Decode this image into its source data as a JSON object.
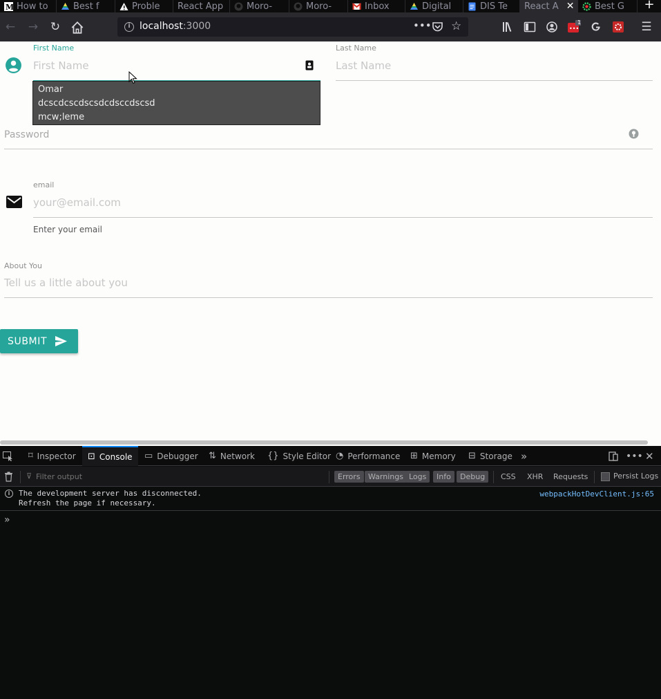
{
  "browser": {
    "tabs": [
      {
        "label": "How to",
        "icon": "medium-icon",
        "active": false
      },
      {
        "label": "Best f",
        "icon": "google-drive-icon",
        "active": false
      },
      {
        "label": "Proble",
        "icon": "warning-icon",
        "active": false
      },
      {
        "label": "React App",
        "icon": "",
        "active": false
      },
      {
        "label": "Moro-",
        "icon": "github-icon",
        "active": false
      },
      {
        "label": "Moro-",
        "icon": "github-icon",
        "active": false
      },
      {
        "label": "Inbox",
        "icon": "gmail-icon",
        "active": false
      },
      {
        "label": "Digital",
        "icon": "google-drive-icon",
        "active": false
      },
      {
        "label": "DIS Te",
        "icon": "google-docs-icon",
        "active": false
      },
      {
        "label": "React A",
        "icon": "",
        "active": true
      },
      {
        "label": "Best G",
        "icon": "gear-icon",
        "active": false
      }
    ],
    "url_host": "localhost",
    "url_port": ":3000",
    "badge_count": "1"
  },
  "form": {
    "first_name": {
      "label": "First Name",
      "placeholder": "First Name"
    },
    "last_name": {
      "label": "Last Name",
      "placeholder": "Last Name"
    },
    "suggestions": [
      "Omar",
      "dcscdcscdscsdcdsccdscsd",
      "mcw;leme"
    ],
    "password": {
      "placeholder": "Password"
    },
    "email": {
      "label": "email",
      "placeholder": "your@email.com",
      "helper": "Enter your email"
    },
    "about": {
      "label": "About You",
      "placeholder": "Tell us a little about you"
    },
    "submit_label": "SUBMIT"
  },
  "devtools": {
    "tabs": [
      "Inspector",
      "Console",
      "Debugger",
      "Network",
      "Style Editor",
      "Performance",
      "Memory",
      "Storage"
    ],
    "active_tab": "Console",
    "filter_placeholder": "Filter output",
    "levels": [
      "Errors",
      "Warnings",
      "Logs",
      "Info",
      "Debug"
    ],
    "types": [
      "CSS",
      "XHR",
      "Requests"
    ],
    "persist_label": "Persist Logs",
    "messages": [
      {
        "line1": "The development server has disconnected.",
        "line2": "Refresh the page if necessary.",
        "source": "webpackHotDevClient.js:65"
      }
    ],
    "prompt": "»"
  },
  "colors": {
    "accent": "#26a69a",
    "devtools_active": "#0a84ff",
    "link": "#75bfff"
  }
}
